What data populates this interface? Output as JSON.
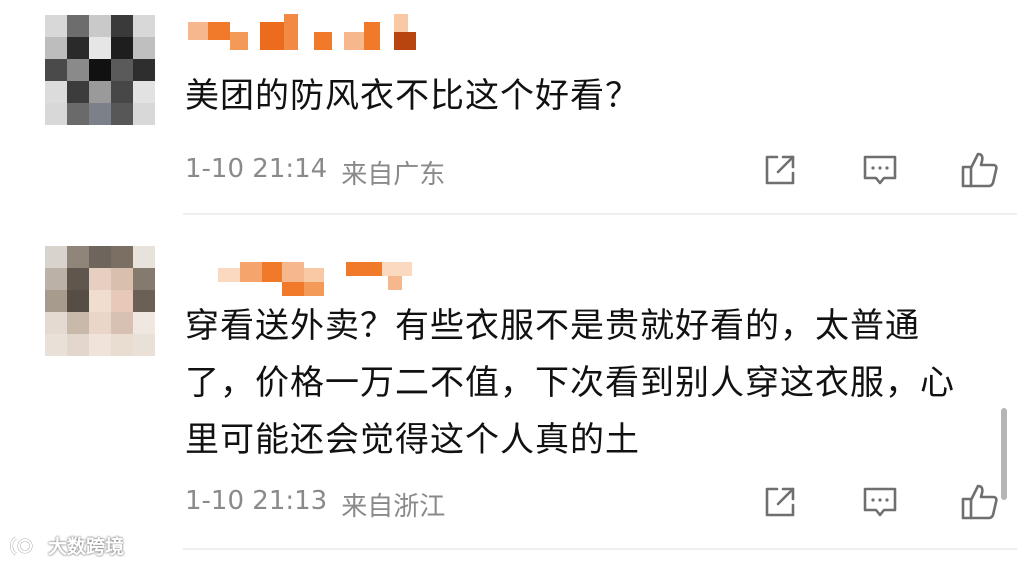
{
  "comments": [
    {
      "text": "美团的防风衣不比这个好看？",
      "time": "1-10 21:14",
      "location": "来自广东",
      "actions": [
        {
          "icon": "share-icon"
        },
        {
          "icon": "comment-icon"
        },
        {
          "icon": "like-icon"
        }
      ]
    },
    {
      "text": "穿看送外卖？有些衣服不是贵就好看的，太普通了，价格一万二不值，下次看到别人穿这衣服，心里可能还会觉得这个人真的土",
      "time": "1-10 21:13",
      "location": "来自浙江",
      "actions": [
        {
          "icon": "share-icon"
        },
        {
          "icon": "comment-icon"
        },
        {
          "icon": "like-icon"
        }
      ]
    }
  ],
  "watermark": {
    "text": "大数跨境"
  },
  "colors": {
    "username_orange": "#f07a2a",
    "meta_gray": "#8a8a8a",
    "icon_gray": "#6f6f6f"
  }
}
